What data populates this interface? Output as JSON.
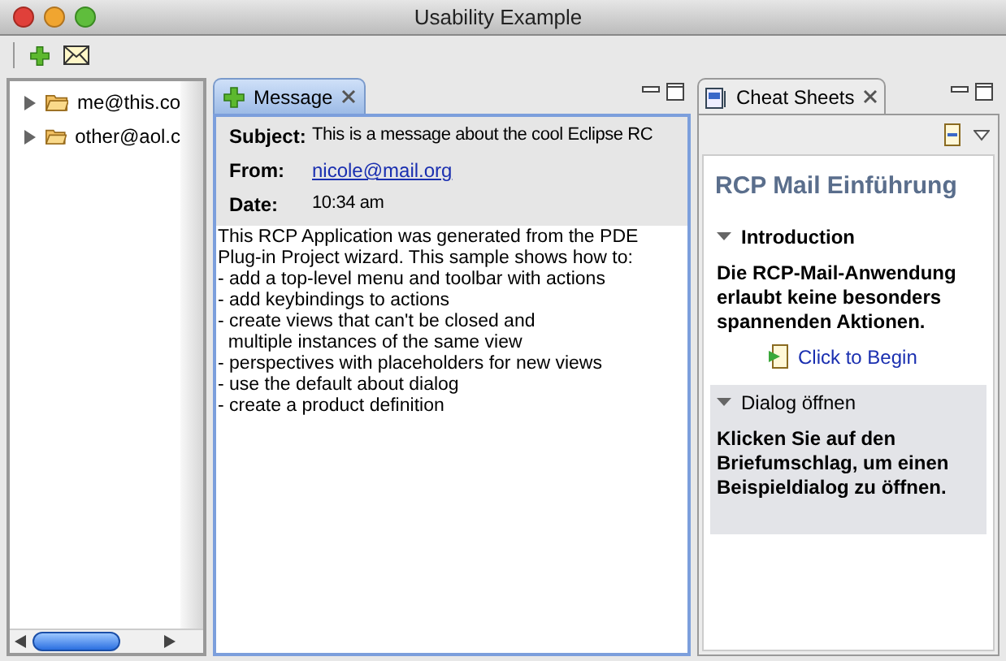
{
  "window": {
    "title": "Usability Example"
  },
  "tree": {
    "items": [
      {
        "label": "me@this.co",
        "expanded": false
      },
      {
        "label": "other@aol.c",
        "expanded": false
      }
    ]
  },
  "message_view": {
    "tab": {
      "label": "Message",
      "selected": true
    },
    "fields": [
      {
        "label": "Subject:",
        "value": "This is a message about the cool Eclipse RC",
        "kind": "text"
      },
      {
        "label": "From:",
        "value": "nicole@mail.org",
        "kind": "link"
      },
      {
        "label": "Date:",
        "value": "10:34 am",
        "kind": "text"
      }
    ],
    "body": [
      "This RCP Application was generated from the PDE",
      "Plug-in Project wizard. This sample shows how to:",
      "- add a top-level menu and toolbar with actions",
      "- add keybindings to actions",
      "- create views that can't be closed and",
      "  multiple instances of the same view",
      "- perspectives with placeholders for new views",
      "- use the default about dialog",
      "- create a product definition"
    ]
  },
  "cheat_sheets": {
    "tab": {
      "label": "Cheat Sheets",
      "selected": false
    },
    "title": "RCP Mail Einführung",
    "sections": [
      {
        "title": "Introduction",
        "expanded": true,
        "selected": false,
        "text": "Die RCP-Mail-Anwendung erlaubt keine besonders spannenden Aktionen.",
        "link": "Click to Begin"
      },
      {
        "title": "Dialog öffnen",
        "expanded": true,
        "selected": true,
        "text": "Klicken Sie auf den Briefumschlag, um einen Beispieldialog zu öffnen."
      }
    ]
  }
}
